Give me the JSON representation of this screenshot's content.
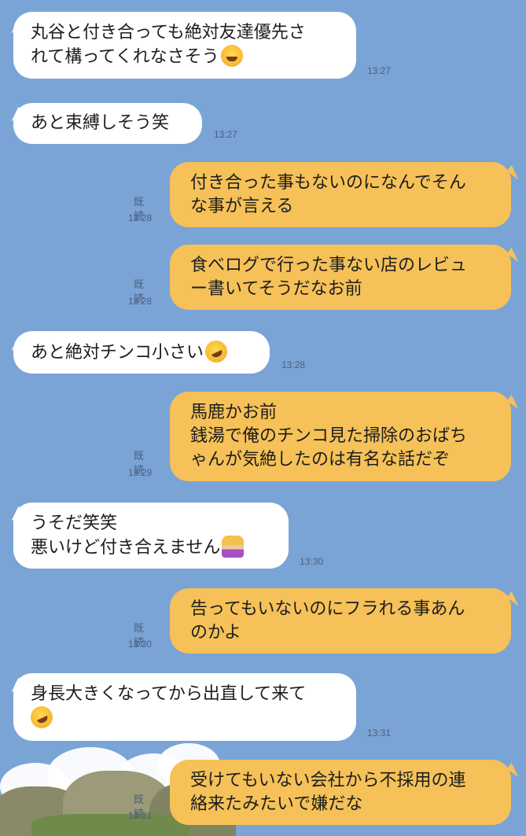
{
  "messages": [
    {
      "side": "in",
      "lines": [
        "丸谷と付き合っても絶対友達優先さ",
        "れて構ってくれなさそう"
      ],
      "emoji": "joy-emoji",
      "time": "13:27"
    },
    {
      "side": "in",
      "lines": [
        "あと束縛しそう笑"
      ],
      "time": "13:27"
    },
    {
      "side": "out",
      "lines": [
        "付き合った事もないのになんでそん",
        "な事が言える"
      ],
      "read": "既読",
      "time": "13:28"
    },
    {
      "side": "out",
      "lines": [
        "食べログで行った事ない店のレビュ",
        "ー書いてそうだなお前"
      ],
      "read": "既読",
      "time": "13:28"
    },
    {
      "side": "in",
      "lines": [
        "あと絶対チンコ小さい"
      ],
      "emoji": "rofl-emoji",
      "time": "13:28"
    },
    {
      "side": "out",
      "lines": [
        "馬鹿かお前",
        "銭湯で俺のチンコ見た掃除のおばち",
        "ゃんが気絶したのは有名な話だぞ"
      ],
      "read": "既読",
      "time": "13:29"
    },
    {
      "side": "in",
      "lines": [
        "うそだ笑笑",
        "悪いけど付き合えません"
      ],
      "emoji": "woman-gesturing-no-emoji",
      "time": "13:30"
    },
    {
      "side": "out",
      "lines": [
        "告ってもいないのにフラれる事あん",
        "のかよ"
      ],
      "read": "既読",
      "time": "13:30"
    },
    {
      "side": "in",
      "lines": [
        "身長大きくなってから出直して来て",
        ""
      ],
      "emoji": "rofl-emoji",
      "time": "13:31"
    },
    {
      "side": "out",
      "lines": [
        "受けてもいない会社から不採用の連",
        "絡来たみたいで嫌だな"
      ],
      "read": "既読",
      "time": "13:31"
    }
  ],
  "colors": {
    "background": "#7aa4d6",
    "incoming_bubble": "#ffffff",
    "outgoing_bubble": "#f5c158"
  }
}
